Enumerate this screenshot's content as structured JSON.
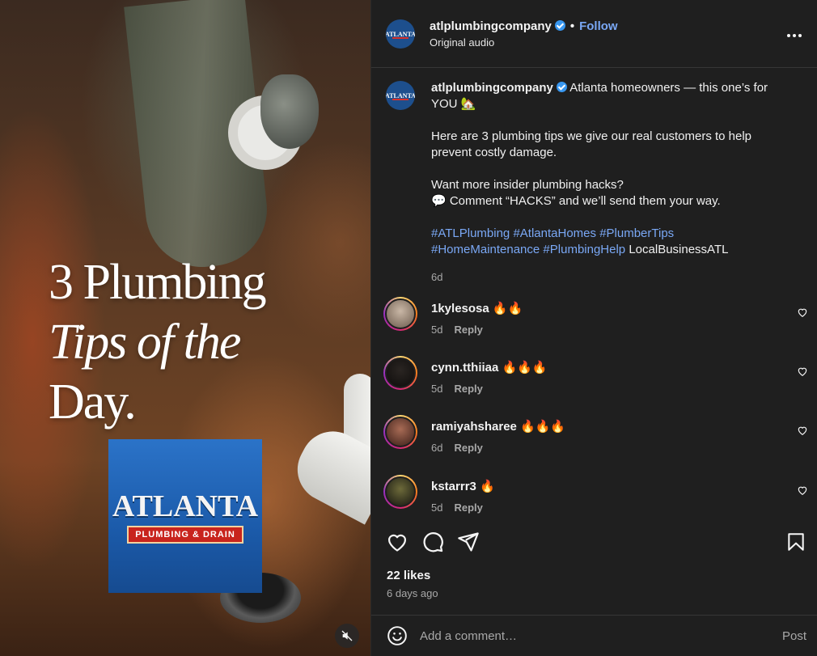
{
  "post": {
    "username": "atlplumbingcompany",
    "follow_label": "Follow",
    "audio_label": "Original audio",
    "dot": "•"
  },
  "media": {
    "title_line1": "3 Plumbing",
    "title_line2": "Tips of the",
    "title_line3": "Day.",
    "logo_text": "ATLANTA",
    "logo_subtext": "PLUMBING & DRAIN"
  },
  "caption": {
    "username": "atlplumbingcompany",
    "line1": "Atlanta homeowners — this one’s for YOU 🏡",
    "line2": "Here are 3 plumbing tips we give our real customers to help prevent costly damage.",
    "line3": "Want more insider plumbing hacks?",
    "line4": "💬 Comment “HACKS” and we’ll send them your way.",
    "tags": [
      "#ATLPlumbing",
      "#AtlantaHomes",
      "#PlumberTips",
      "#HomeMaintenance",
      "#PlumbingHelp"
    ],
    "plain_tag": "LocalBusinessATL",
    "age": "6d"
  },
  "comments": [
    {
      "user": "1kylesosa",
      "text": "🔥🔥",
      "age": "5d",
      "reply": "Reply"
    },
    {
      "user": "cynn.tthiiaa",
      "text": "🔥🔥🔥",
      "age": "5d",
      "reply": "Reply"
    },
    {
      "user": "ramiyahsharee",
      "text": "🔥🔥🔥",
      "age": "6d",
      "reply": "Reply"
    },
    {
      "user": "kstarrr3",
      "text": "🔥",
      "age": "5d",
      "reply": "Reply"
    }
  ],
  "stats": {
    "likes": "22 likes",
    "date": "6 days ago"
  },
  "composer": {
    "placeholder": "Add a comment…",
    "post_label": "Post"
  },
  "icons": {
    "verified": "verified-badge-icon",
    "more": "more-options-icon",
    "like": "heart-icon",
    "comment": "comment-icon",
    "share": "share-icon",
    "save": "bookmark-icon",
    "emoji": "emoji-icon",
    "mute": "muted-speaker-icon"
  }
}
